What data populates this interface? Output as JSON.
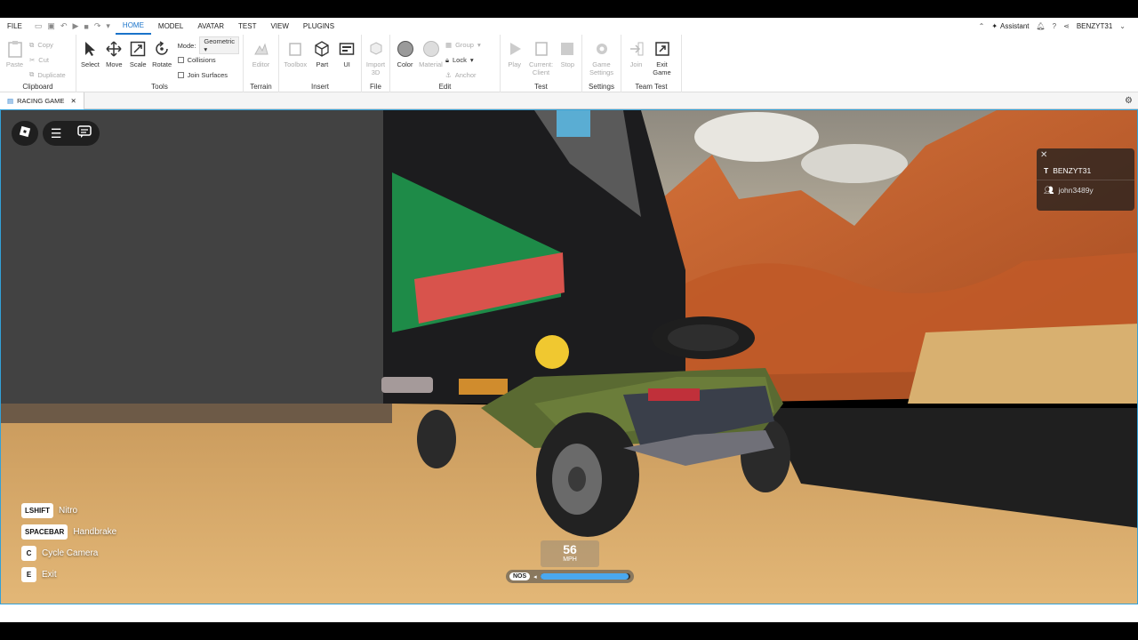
{
  "menubar": {
    "items": [
      "FILE",
      "HOME",
      "MODEL",
      "AVATAR",
      "TEST",
      "VIEW",
      "PLUGINS"
    ],
    "active": "HOME",
    "assistant": "Assistant",
    "username": "BENZYT31"
  },
  "ribbon": {
    "clipboard": {
      "label": "Clipboard",
      "paste": "Paste",
      "copy": "Copy",
      "cut": "Cut",
      "duplicate": "Duplicate"
    },
    "tools": {
      "label": "Tools",
      "select": "Select",
      "move": "Move",
      "scale": "Scale",
      "rotate": "Rotate",
      "mode_label": "Mode:",
      "mode_value": "Geometric",
      "collisions": "Collisions",
      "join_surfaces": "Join Surfaces"
    },
    "terrain": {
      "label": "Terrain",
      "editor": "Editor"
    },
    "insert": {
      "label": "Insert",
      "toolbox": "Toolbox",
      "part": "Part",
      "ui": "UI"
    },
    "file": {
      "label": "File",
      "import3d": "Import 3D"
    },
    "edit": {
      "label": "Edit",
      "color": "Color",
      "material": "Material",
      "group": "Group",
      "lock": "Lock",
      "anchor": "Anchor"
    },
    "test": {
      "label": "Test",
      "play": "Play",
      "current_client": "Current: Client",
      "stop": "Stop"
    },
    "settings": {
      "label": "Settings",
      "game_settings": "Game Settings"
    },
    "teamtest": {
      "label": "Team Test",
      "join": "Join",
      "exit_game": "Exit Game"
    }
  },
  "tabbar": {
    "doc_tab": "RACING GAME"
  },
  "game": {
    "players": [
      "BENZYT31",
      "john3489y"
    ],
    "controls": [
      {
        "key": "LSHIFT",
        "action": "Nitro"
      },
      {
        "key": "SPACEBAR",
        "action": "Handbrake"
      },
      {
        "key": "C",
        "action": "Cycle Camera"
      },
      {
        "key": "E",
        "action": "Exit"
      }
    ],
    "speed": "56",
    "speed_unit": "MPH",
    "nos_label": "NOS",
    "nos_level": 0.98
  },
  "colors": {
    "accent": "#1a73c9",
    "viewport_border": "#33a1d8",
    "nos_fill": "#4aa8ef",
    "sand": "#d9a968",
    "rock": "#c8612c"
  }
}
